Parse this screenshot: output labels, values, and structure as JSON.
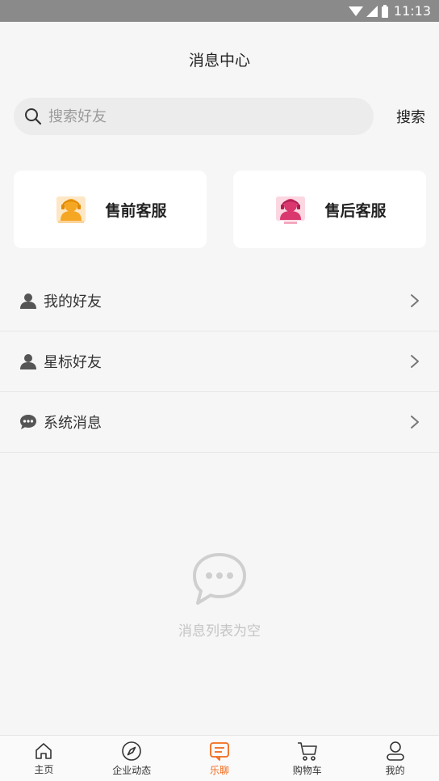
{
  "status_bar": {
    "time": "11:13"
  },
  "header": {
    "title": "消息中心"
  },
  "search": {
    "placeholder": "搜索好友",
    "value": "",
    "button_label": "搜索"
  },
  "service_cards": [
    {
      "label": "售前客服",
      "icon": "customer-service-orange-icon",
      "color": "#f5a623"
    },
    {
      "label": "售后客服",
      "icon": "customer-service-pink-icon",
      "color": "#d9376e"
    }
  ],
  "menu": {
    "items": [
      {
        "label": "我的好友",
        "icon": "person-icon"
      },
      {
        "label": "星标好友",
        "icon": "person-icon"
      },
      {
        "label": "系统消息",
        "icon": "chat-bubble-icon"
      }
    ]
  },
  "empty_state": {
    "text": "消息列表为空",
    "icon": "chat-bubble-outline-icon"
  },
  "tabbar": {
    "tabs": [
      {
        "label": "主页",
        "icon": "home-icon"
      },
      {
        "label": "企业动态",
        "icon": "compass-icon"
      },
      {
        "label": "乐聊",
        "icon": "message-icon",
        "active": true
      },
      {
        "label": "购物车",
        "icon": "cart-icon"
      },
      {
        "label": "我的",
        "icon": "user-icon"
      }
    ]
  },
  "colors": {
    "accent": "#f26a1b",
    "background": "#f6f6f6"
  }
}
